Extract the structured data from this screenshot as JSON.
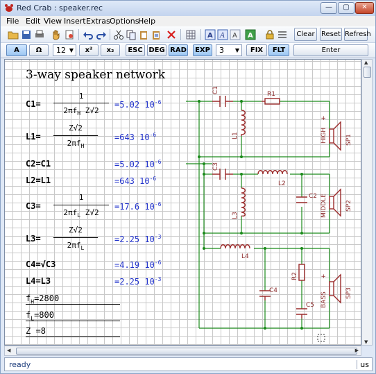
{
  "window": {
    "title": "Red Crab : speaker.rec"
  },
  "menu": [
    "File",
    "Edit",
    "View",
    "Insert",
    "Extras",
    "Options",
    "Help"
  ],
  "toolbar": {
    "clear": "Clear",
    "reset": "Reset",
    "refresh": "Refresh",
    "icons": [
      "open-folder-icon",
      "save-icon",
      "print-icon",
      "hand-icon",
      "preview-icon",
      "undo-icon",
      "redo-icon",
      "cut-icon",
      "copy-icon",
      "paste-icon",
      "paste-special-icon",
      "delete-icon",
      "grid-icon",
      "font-a-icon",
      "font-a-alt-icon",
      "font-a-plain-icon",
      "text-color-icon",
      "lock-icon",
      "lines-icon"
    ]
  },
  "toolbar2": {
    "a": "A",
    "omega": "Ω",
    "font_size": "12",
    "square": "x²",
    "subscript": "x₂",
    "esc": "ESC",
    "deg": "DEG",
    "rad": "RAD",
    "exp": "EXP",
    "digits": "3",
    "fix": "FIX",
    "flt": "FLT",
    "enter": "Enter"
  },
  "document": {
    "title": "3-way speaker network",
    "c1": {
      "lhs": "C1=",
      "num": "1",
      "den": "2πf",
      "den_sub": "H",
      "den_tail": "Z√2",
      "res": "=5.02  10",
      "exp": "-6"
    },
    "l1": {
      "lhs": "L1=",
      "num": "Z√2",
      "den": "2πf",
      "den_sub": "H",
      "res": "=643  10",
      "exp": "-6"
    },
    "c2": {
      "lhs": "C2=C1",
      "res": "=5.02  10",
      "exp": "-6"
    },
    "l2": {
      "lhs": "L2=L1",
      "res": "=643  10",
      "exp": "-6"
    },
    "c3": {
      "lhs": "C3=",
      "num": "1",
      "den": "2πf",
      "den_sub": "L",
      "den_tail": "Z√2",
      "res": "=17.6  10",
      "exp": "-6"
    },
    "l3": {
      "lhs": "L3=",
      "num": "Z√2",
      "den": "2πf",
      "den_sub": "L",
      "res": "=2.25  10",
      "exp": "-3"
    },
    "c4": {
      "lhs": "C4=√C3",
      "res": "=4.19  10",
      "exp": "-6"
    },
    "l4": {
      "lhs": "L4=L3",
      "res": "=2.25  10",
      "exp": "-3"
    },
    "fh": {
      "name": "f",
      "sub": "H",
      "val": "=2800"
    },
    "fl": {
      "name": "f",
      "sub": "L",
      "val": "=800"
    },
    "z": {
      "name": "Z",
      "val": "=8"
    }
  },
  "schematic": {
    "labels": {
      "c1": "C1",
      "r1": "R1",
      "l1": "L1",
      "high": "HIGH",
      "sp1": "SP1",
      "c3": "C3",
      "l2": "L2",
      "l3": "L3",
      "c2": "C2",
      "middle": "MIDDLE",
      "sp2": "SP2",
      "l4": "L4",
      "r2": "R2",
      "c4": "C4",
      "c5": "C5",
      "bass": "BASS",
      "sp3": "SP3",
      "plus": "+"
    },
    "colors": {
      "wire": "#1a8a1a",
      "part": "#9b2a2a"
    }
  },
  "status": {
    "text": "ready",
    "right": "us"
  }
}
